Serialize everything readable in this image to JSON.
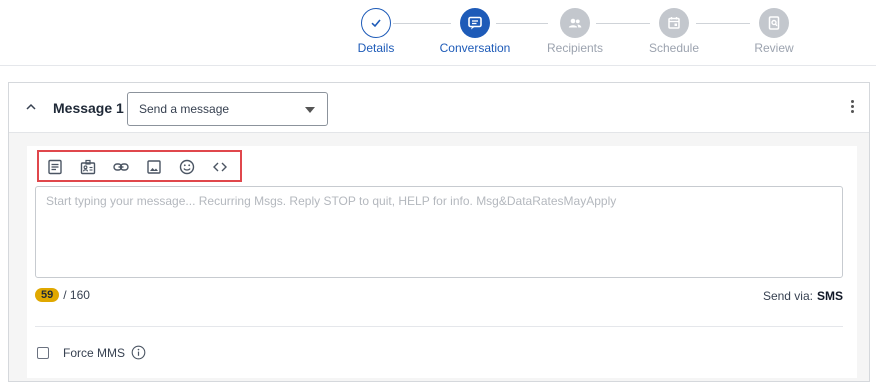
{
  "stepper": {
    "steps": [
      {
        "label": "Details",
        "state": "done",
        "icon": "check-icon"
      },
      {
        "label": "Conversation",
        "state": "active",
        "icon": "chat-icon"
      },
      {
        "label": "Recipients",
        "state": "future",
        "icon": "users-icon"
      },
      {
        "label": "Schedule",
        "state": "future",
        "icon": "calendar-icon"
      },
      {
        "label": "Review",
        "state": "future",
        "icon": "review-icon"
      }
    ]
  },
  "message": {
    "title": "Message 1",
    "type_select": {
      "value": "Send a message"
    },
    "toolbar": [
      "template-icon",
      "contact-card-icon",
      "link-icon",
      "image-icon",
      "emoji-icon",
      "code-icon"
    ],
    "textarea": {
      "value": "",
      "placeholder": "Start typing your message... Recurring Msgs. Reply STOP to quit, HELP for info. Msg&DataRatesMayApply"
    },
    "char_count": "59",
    "char_limit": "/ 160",
    "send_via_label": "Send via:",
    "send_via_value": "SMS",
    "force_mms_label": "Force MMS",
    "force_mms_checked": false
  },
  "colors": {
    "accent": "#1e5bb8",
    "inactive_step": "#c3c7cd",
    "badge": "#e0a800",
    "highlight_box": "#e0474c"
  }
}
